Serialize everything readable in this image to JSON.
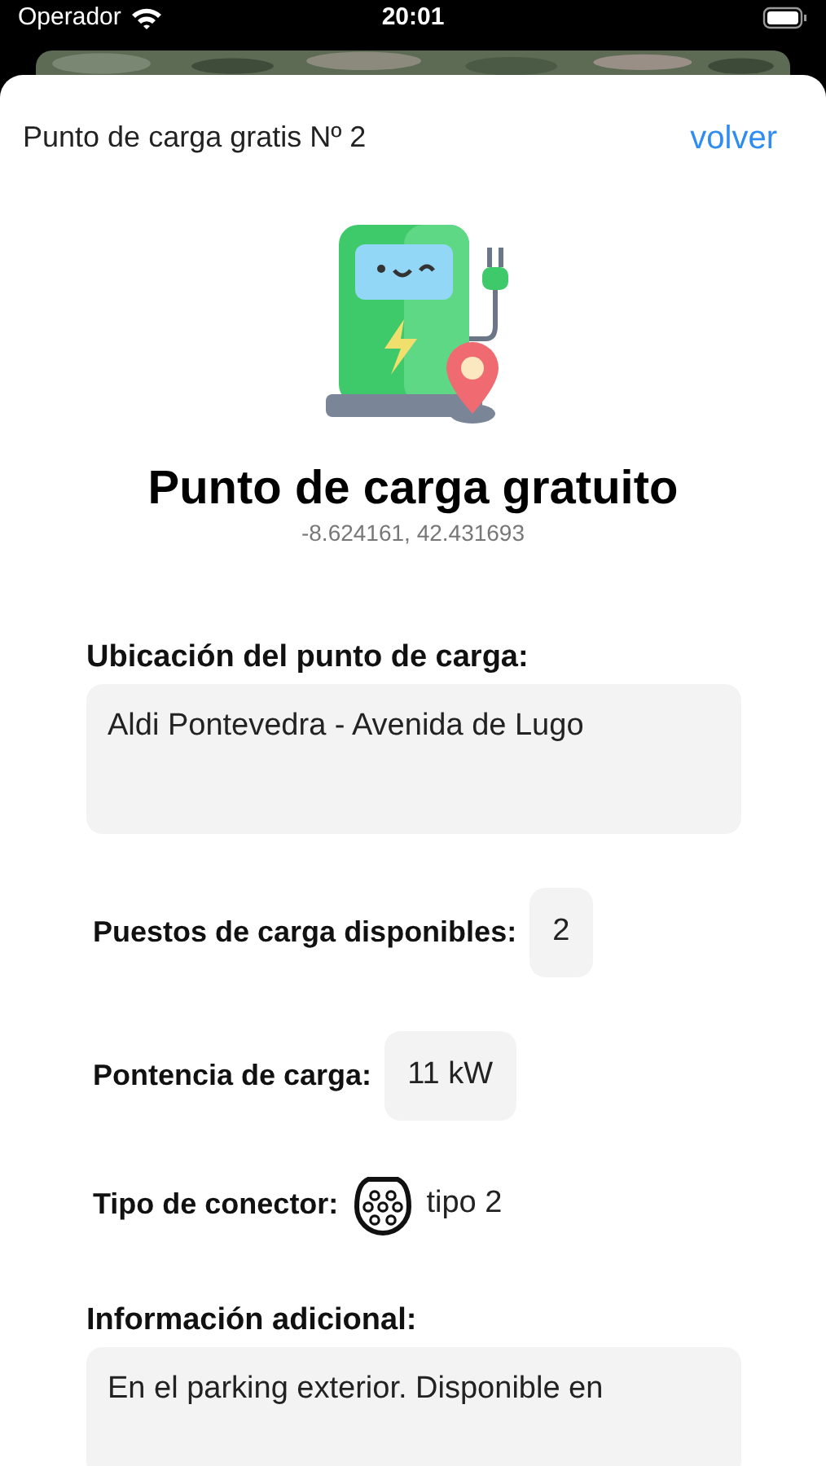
{
  "status_bar": {
    "carrier": "Operador",
    "time": "20:01"
  },
  "header": {
    "title": "Punto de carga gratis Nº 2",
    "back": "volver"
  },
  "station": {
    "title": "Punto de carga gratuito",
    "coordinates": "-8.624161, 42.431693"
  },
  "location": {
    "label": "Ubicación del punto de carga:",
    "value": "Aldi Pontevedra - Avenida de Lugo"
  },
  "details": [
    {
      "kind": "value",
      "label": "Puestos de carga disponibles:",
      "value": "2"
    },
    {
      "kind": "value",
      "label": "Pontencia de carga:",
      "value": "11 kW"
    },
    {
      "kind": "connector",
      "label": "Tipo de conector:",
      "value": "tipo 2"
    }
  ],
  "additional": {
    "label": "Información adicional:",
    "value": "En el parking exterior. Disponible en"
  }
}
